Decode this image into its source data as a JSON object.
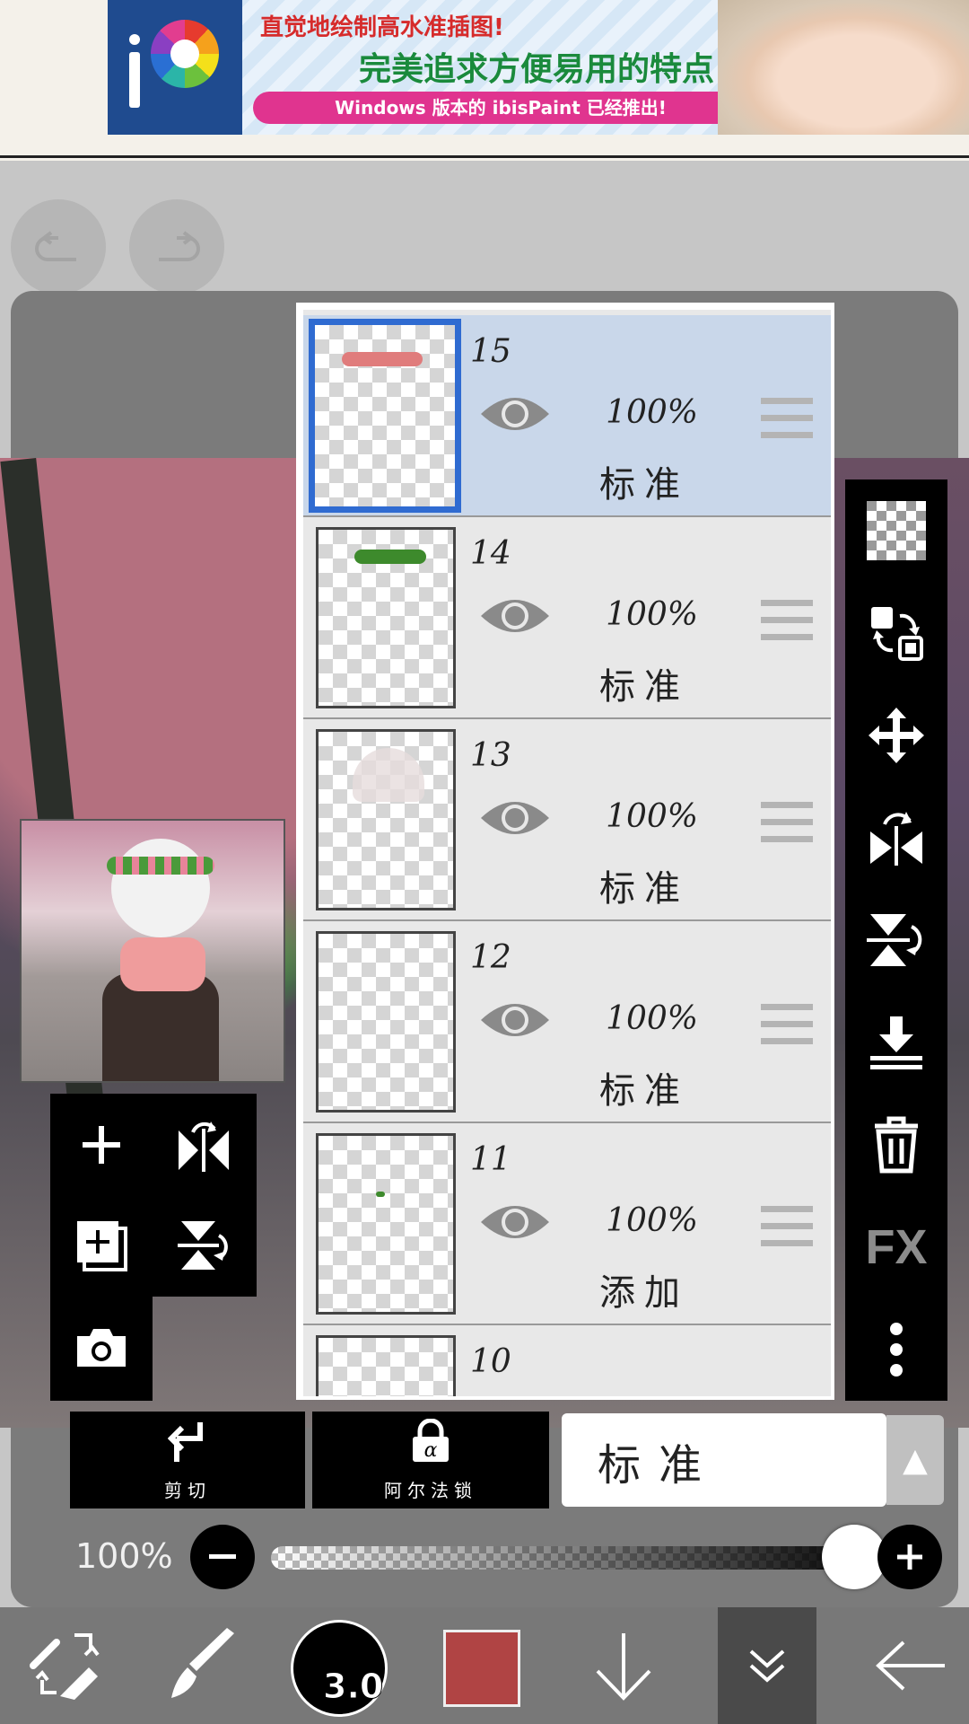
{
  "ad": {
    "line1": "直觉地绘制高水准插图!",
    "line2": "完美追求方便易用的特点!",
    "line3": "Windows 版本的 ibisPaint 已经推出!",
    "logo_icon": "ibispaint-logo-icon"
  },
  "history": {
    "undo_icon": "undo-icon",
    "redo_icon": "redo-icon"
  },
  "layers": [
    {
      "number": "15",
      "opacity": "100%",
      "blend": "标准",
      "visible": true,
      "selected": true
    },
    {
      "number": "14",
      "opacity": "100%",
      "blend": "标准",
      "visible": true,
      "selected": false
    },
    {
      "number": "13",
      "opacity": "100%",
      "blend": "标准",
      "visible": true,
      "selected": false
    },
    {
      "number": "12",
      "opacity": "100%",
      "blend": "标准",
      "visible": true,
      "selected": false
    },
    {
      "number": "11",
      "opacity": "100%",
      "blend": "添加",
      "visible": true,
      "selected": false
    },
    {
      "number": "10"
    }
  ],
  "right_toolbar": {
    "items": [
      "transparent-grid-icon",
      "move-layer-content-icon",
      "move-arrows-icon",
      "flip-horizontal-icon",
      "flip-vertical-icon",
      "merge-down-icon",
      "trash-icon",
      "fx-icon",
      "more-vertical-icon"
    ],
    "fx_label": "FX"
  },
  "left_toolbar": {
    "items": [
      "add-layer-icon",
      "flip-layer-icon",
      "add-copy-layer-icon",
      "flip-vertical-layer-icon",
      "camera-icon"
    ]
  },
  "bottom_actions": {
    "clip_label": "剪切",
    "alpha_lock_label": "阿尔法锁",
    "blend_mode_value": "标准"
  },
  "opacity": {
    "label": "100%",
    "value_percent": 100
  },
  "bottom_nav": {
    "brush_size": "3.0",
    "color": "#b04444"
  },
  "colors": {
    "selected_layer_bg": "#c9d7ea",
    "selected_border": "#2f6bd1",
    "panel_black": "#000000"
  }
}
